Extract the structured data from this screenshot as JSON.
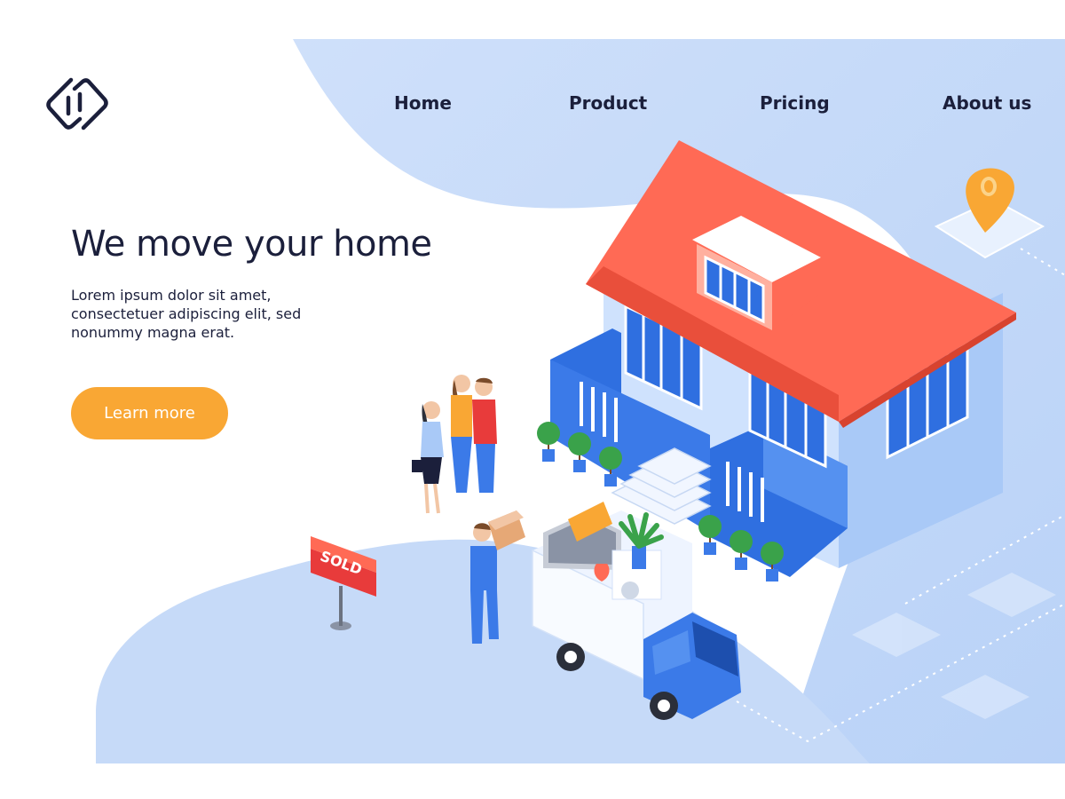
{
  "logo": {
    "icon": "link-chain-logo-icon"
  },
  "nav": {
    "items": [
      "Home",
      "Product",
      "Pricing",
      "About us"
    ]
  },
  "hero": {
    "title": "We move your home",
    "lines": [
      "Lorem ipsum dolor sit amet,",
      "consectetuer adipiscing elit, sed",
      "nonummy magna erat."
    ],
    "cta_label": "Learn more"
  },
  "illustration": {
    "sign_text": "SOLD",
    "pin_icon": "location-pin-icon"
  },
  "colors": {
    "accent": "#f9a734",
    "blob": "#c9dcf8",
    "roof": "#ff6a55",
    "house": "#3b7ae8",
    "text": "#1b1f3b",
    "sold": "#e83b3b"
  }
}
